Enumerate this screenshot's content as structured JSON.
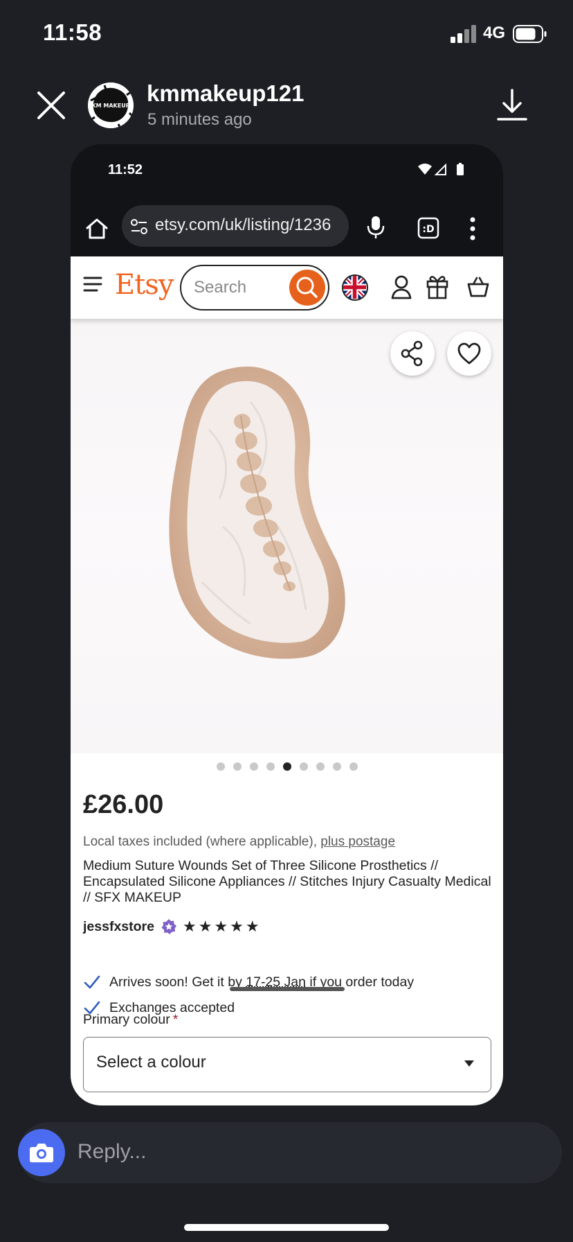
{
  "ios_status": {
    "time": "11:58",
    "network": "4G"
  },
  "story": {
    "username": "kmmakeup121",
    "posted": "5 minutes ago",
    "avatar_text": "KM MAKEUP"
  },
  "android_status": {
    "time": "11:52"
  },
  "browser": {
    "url": "etsy.com/uk/listing/1236"
  },
  "etsy": {
    "logo": "Etsy",
    "search_placeholder": "Search",
    "carousel": {
      "total": 9,
      "active_index": 4
    },
    "price": "£26.00",
    "tax_text": "Local taxes included (where applicable), ",
    "postage_link": "plus postage",
    "title": "Medium Suture Wounds Set of Three Silicone Prosthetics // Encapsulated Silicone Appliances // Stitches Injury Casualty Medical // SFX MAKEUP",
    "shop_name": "jessfxstore",
    "rating_stars": "★★★★★",
    "delivery_prefix": "Arrives soon! Get it by ",
    "delivery_dates": "17-25 Jan",
    "delivery_suffix": " if you order today",
    "exchanges": "Exchanges accepted",
    "colour_label": "Primary colour",
    "required_mark": "*",
    "colour_select": "Select a colour"
  },
  "reply": {
    "placeholder": "Reply..."
  },
  "colors": {
    "etsy_orange": "#f1641e",
    "search_button": "#e6621c",
    "camera_button": "#4b6cf0",
    "background": "#1d1f24"
  }
}
